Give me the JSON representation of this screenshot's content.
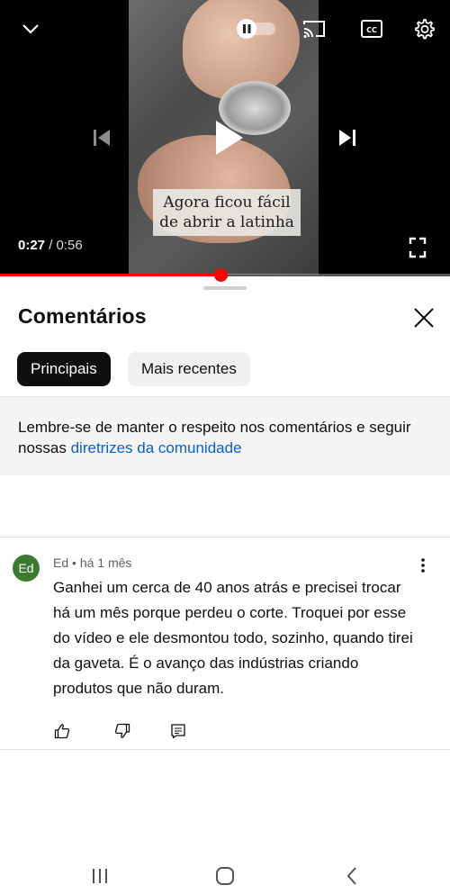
{
  "player": {
    "current_time": "0:27",
    "separator": " / ",
    "duration": "0:56",
    "progress_fraction": 0.489,
    "caption_lines": [
      "Agora ficou fácil",
      "de abrir a latinha"
    ],
    "icons": {
      "collapse": "chevron-down-icon",
      "autoplay": "autoplay-toggle-icon",
      "cast": "cast-icon",
      "captions": "closed-captions-icon",
      "settings": "gear-icon",
      "previous": "skip-previous-icon",
      "play": "play-icon",
      "next": "skip-next-icon",
      "fullscreen": "fullscreen-icon"
    }
  },
  "comments_panel": {
    "title": "Comentários",
    "chips": [
      {
        "label": "Principais",
        "selected": true
      },
      {
        "label": "Mais recentes",
        "selected": false
      }
    ],
    "notice": {
      "text": "Lembre-se de manter o respeito nos comentários e seguir nossas ",
      "link": "diretrizes da comunidade"
    },
    "comments": [
      {
        "avatar_initials": "Ed",
        "author": "Ed",
        "meta_separator": " • ",
        "time": "há 1 mês",
        "text": "Ganhei um cerca de 40 anos atrás e precisei trocar há um mês porque perdeu o corte. Troquei por esse do vídeo e ele desmontou todo, sozinho, quando tirei da gaveta. É o avanço das indústrias criando produtos que não duram."
      }
    ]
  },
  "colors": {
    "accent_red": "#ff0000",
    "link_blue": "#065fd4",
    "avatar_green": "#3c7a2e",
    "chip_active_bg": "#0f0f0f"
  }
}
